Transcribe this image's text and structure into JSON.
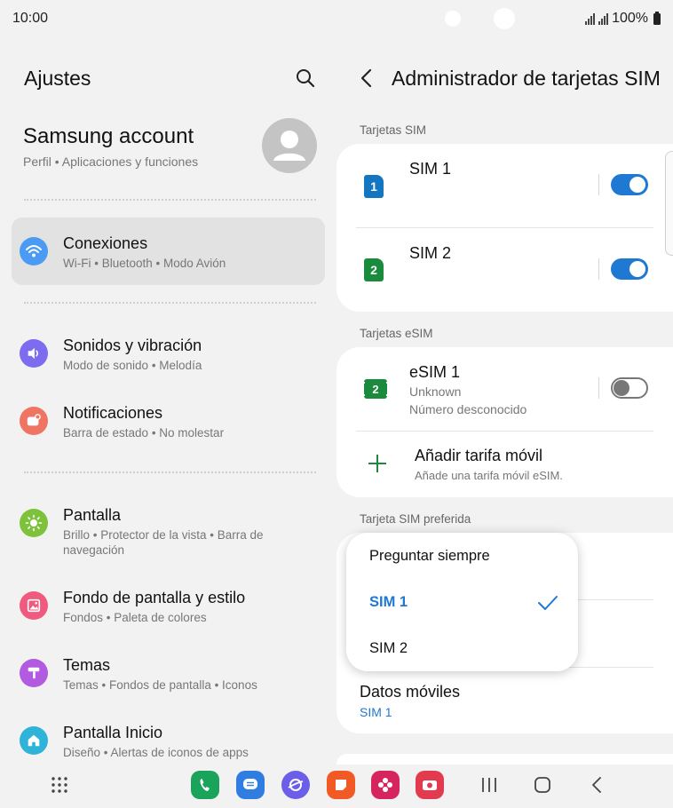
{
  "status": {
    "time": "10:00",
    "battery": "100%"
  },
  "left": {
    "title": "Ajustes",
    "account": {
      "name": "Samsung account",
      "subtitle": "Perfil • Aplicaciones y funciones"
    },
    "items": [
      {
        "title": "Conexiones",
        "subtitle": "Wi-Fi • Bluetooth • Modo Avión",
        "icon": "wifi-icon",
        "color": "#4b9bf5"
      },
      {
        "title": "Sonidos y vibración",
        "subtitle": "Modo de sonido • Melodía",
        "icon": "volume-icon",
        "color": "#7d6cf0"
      },
      {
        "title": "Notificaciones",
        "subtitle": "Barra de estado • No molestar",
        "icon": "notification-icon",
        "color": "#f07462"
      },
      {
        "title": "Pantalla",
        "subtitle": "Brillo • Protector de la vista • Barra de navegación",
        "icon": "sun-icon",
        "color": "#7dc23a"
      },
      {
        "title": "Fondo de pantalla y estilo",
        "subtitle": "Fondos • Paleta de colores",
        "icon": "wallpaper-icon",
        "color": "#ef5a7e"
      },
      {
        "title": "Temas",
        "subtitle": "Temas • Fondos de pantalla • Iconos",
        "icon": "brush-icon",
        "color": "#b25ae0"
      },
      {
        "title": "Pantalla Inicio",
        "subtitle": "Diseño • Alertas de iconos de apps",
        "icon": "home-icon",
        "color": "#2fb3d8"
      }
    ]
  },
  "right": {
    "title": "Administrador de tarjetas SIM",
    "sim_section": "Tarjetas SIM",
    "sim1": {
      "label": "SIM 1",
      "badge": "1",
      "enabled": true
    },
    "sim2": {
      "label": "SIM 2",
      "badge": "2",
      "enabled": true
    },
    "esim_section": "Tarjetas eSIM",
    "esim1": {
      "label": "eSIM 1",
      "badge": "2",
      "line1": "Unknown",
      "line2": "Número desconocido",
      "enabled": false
    },
    "add_plan": {
      "title": "Añadir tarifa móvil",
      "subtitle": "Añade una tarifa móvil eSIM."
    },
    "preferred_section": "Tarjeta SIM preferida",
    "mobile_data": {
      "title": "Datos móviles",
      "value": "SIM 1"
    }
  },
  "popup": {
    "options": [
      "Preguntar siempre",
      "SIM 1",
      "SIM 2"
    ],
    "selected": "SIM 1"
  },
  "colors": {
    "accent": "#1f78d1",
    "sim_blue": "#1276c1",
    "sim_green": "#1a8a3c"
  }
}
